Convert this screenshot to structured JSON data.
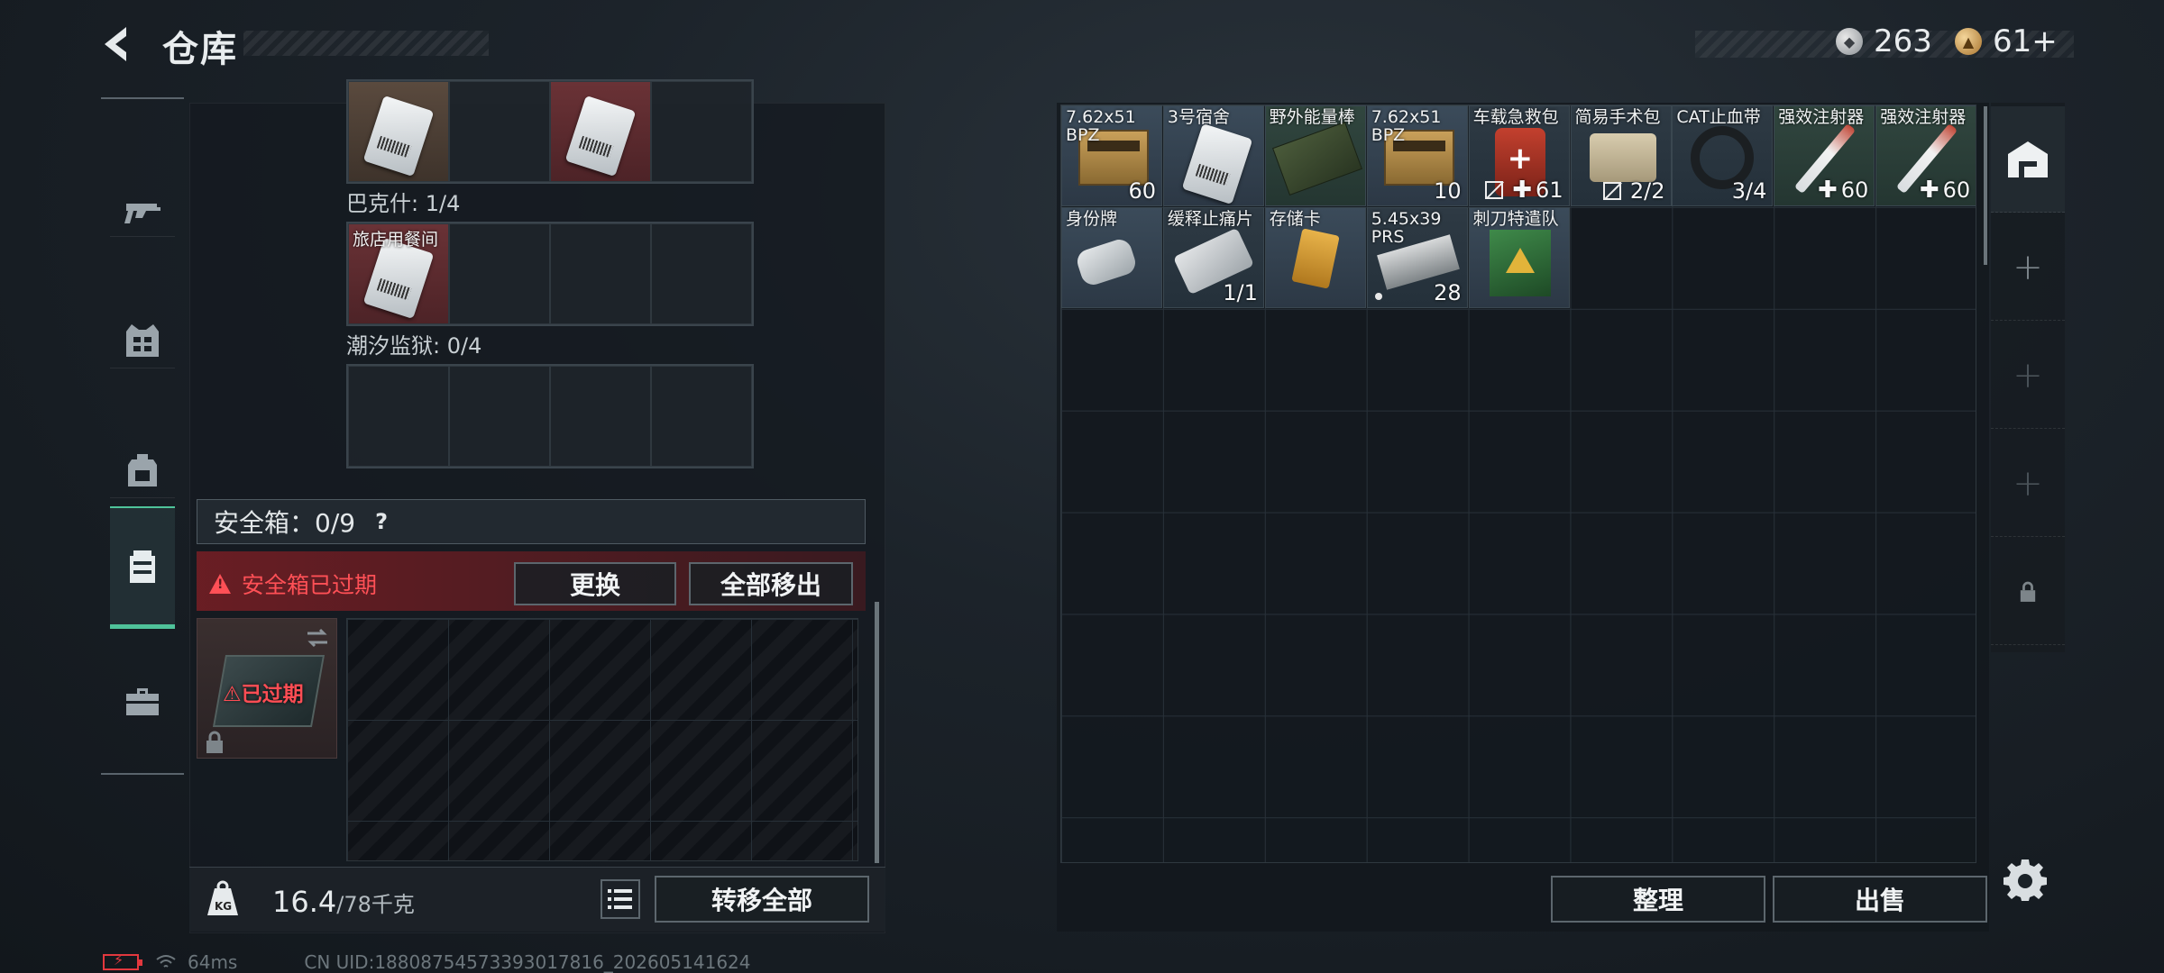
{
  "header": {
    "title": "仓库",
    "currency_silver": "263",
    "currency_gold": "61+"
  },
  "nav": {
    "items": [
      {
        "icon": "gun-icon",
        "active": false
      },
      {
        "icon": "armor-vest-icon",
        "active": false
      },
      {
        "icon": "backpack-icon",
        "active": false
      },
      {
        "icon": "container-icon",
        "active": true
      },
      {
        "icon": "toolbox-icon",
        "active": false
      }
    ]
  },
  "left": {
    "group1_label": "巴克什: 1/4",
    "group2_label": "潮汐监狱: 0/4",
    "group2_item_name": "旅店用餐间",
    "safe_label": "安全箱：0/9",
    "safe_help": "?",
    "expired_message": "安全箱已过期",
    "replace_button": "更换",
    "remove_all_button": "全部移出",
    "safe_box_status": "已过期",
    "weight_value": "16.4",
    "weight_max": "/78千克",
    "weight_icon_label": "KG",
    "transfer_all_button": "转移全部"
  },
  "stash": {
    "items": [
      {
        "name": "7.62x51 BPZ",
        "qty": "60",
        "art": "ammo-box",
        "color": "c-blue"
      },
      {
        "name": "3号宿舍",
        "qty": "",
        "art": "card",
        "color": "c-blue"
      },
      {
        "name": "野外能量棒",
        "qty": "",
        "art": "bar-pack",
        "color": "c-green"
      },
      {
        "name": "7.62x51 BPZ",
        "qty": "10",
        "art": "ammo-box",
        "color": "c-blue"
      },
      {
        "name": "车载急救包",
        "qty": "61",
        "art": "medkit",
        "color": "c-dark",
        "nobox": true,
        "plus": true
      },
      {
        "name": "简易手术包",
        "qty": "2/2",
        "art": "pouch",
        "color": "c-dark",
        "nobox": true
      },
      {
        "name": "CAT止血带",
        "qty": "3/4",
        "art": "tourniquet",
        "color": "c-dark"
      },
      {
        "name": "强效注射器",
        "qty": "60",
        "art": "syringe",
        "color": "c-green",
        "plus": true
      },
      {
        "name": "强效注射器",
        "qty": "60",
        "art": "syringe",
        "color": "c-green",
        "plus": true
      },
      {
        "name": "身份牌",
        "qty": "",
        "art": "dogtag",
        "color": "c-blue"
      },
      {
        "name": "缓释止痛片",
        "qty": "1/1",
        "art": "pills",
        "color": "c-dark"
      },
      {
        "name": "存储卡",
        "qty": "",
        "art": "sdcard",
        "color": "c-blue"
      },
      {
        "name": "5.45x39 PRS",
        "qty": "28",
        "art": "ammo545",
        "color": "c-dark",
        "dot": true
      },
      {
        "name": "刺刀特遣队",
        "qty": "",
        "art": "book",
        "color": "c-blue"
      }
    ],
    "sort_button": "整理",
    "sell_button": "出售"
  },
  "footer": {
    "ping": "64ms",
    "uid": "CN UID:18808754573393017816_202605141624"
  },
  "colors": {
    "accent": "#4fc39a",
    "alert": "#ff5056"
  }
}
